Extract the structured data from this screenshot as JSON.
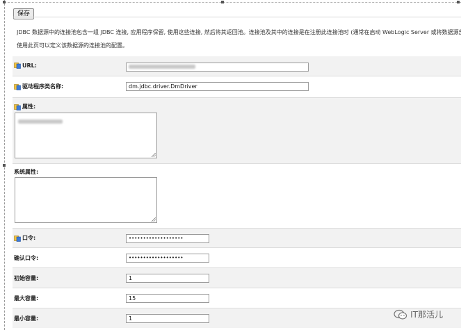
{
  "toolbar": {
    "save_label": "保存"
  },
  "description": {
    "line1": "JDBC 数据源中的连接池包含一组 JDBC 连接, 应用程序保留, 使用这些连接, 然后将其返回池。连接池及其中的连接是在注册此连接池时 (通常在启动 WebLogic Server 或将数据源部",
    "line2": "使用此页可以定义该数据源的连接池的配置。"
  },
  "form": {
    "url": {
      "label": "URL:",
      "value": ""
    },
    "driver": {
      "label": "驱动程序类名称:",
      "value": "dm.jdbc.driver.DmDriver"
    },
    "properties": {
      "label": "属性:",
      "value": ""
    },
    "system_properties": {
      "label": "系统属性:",
      "value": ""
    },
    "password": {
      "label": "口令:",
      "value": "•••••••••••••••••••"
    },
    "confirm_password": {
      "label": "确认口令:",
      "value": "•••••••••••••••••••"
    },
    "initial_capacity": {
      "label": "初始容量:",
      "value": "1"
    },
    "max_capacity": {
      "label": "最大容量:",
      "value": "15"
    },
    "min_capacity": {
      "label": "最小容量:",
      "value": "1"
    }
  },
  "watermark": {
    "text": "IT那活儿"
  }
}
